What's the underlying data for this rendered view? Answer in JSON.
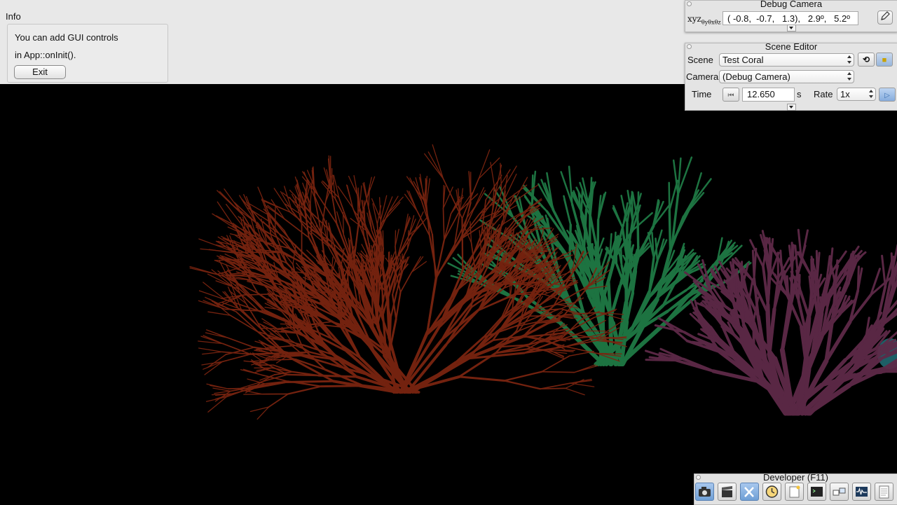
{
  "info_panel": {
    "title": "Info",
    "line1": "You can add GUI controls",
    "line2": "in App::onInit().",
    "exit_label": "Exit"
  },
  "debug_camera": {
    "title": "Debug Camera",
    "label": "xyz",
    "label_subscripts": [
      "θ",
      "y",
      "θ",
      "x",
      "θ",
      "z"
    ],
    "coordinates": "( -0.8,  -0.7,   1.3),   2.9º,   5.2º"
  },
  "scene_editor": {
    "title": "Scene Editor",
    "scene_label": "Scene",
    "scene_value": "Test Coral",
    "camera_label": "Camera",
    "camera_value": "(Debug Camera)",
    "time_label": "Time",
    "time_value": "12.650",
    "time_unit": "s",
    "rate_label": "Rate",
    "rate_value": "1x"
  },
  "developer": {
    "title": "Developer (F11)",
    "icons": [
      "camera-icon",
      "clapperboard-icon",
      "tools-icon",
      "clock-icon",
      "note-icon",
      "terminal-icon",
      "windows-icon",
      "waveform-icon",
      "document-icon"
    ]
  },
  "colors": {
    "coral_red": "#7a2410",
    "coral_green": "#1f7a45",
    "coral_purple": "#5e2a48",
    "coral_teal": "#1d5f66",
    "ui_background": "#e8e8e8"
  }
}
